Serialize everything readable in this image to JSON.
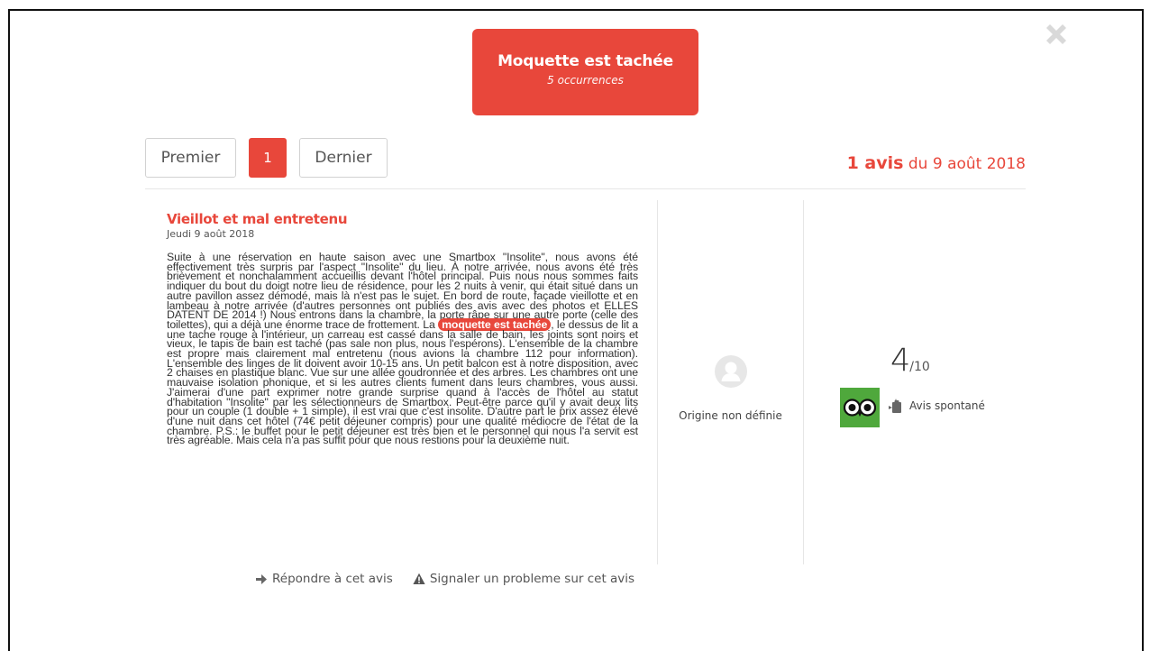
{
  "hero": {
    "title": "Moquette est tachée",
    "subtitle": "5 occurrences"
  },
  "pagination": {
    "first_label": "Premier",
    "current_page": "1",
    "last_label": "Dernier"
  },
  "summary": {
    "count_label": "1 avis",
    "date_label": "du 9 août 2018"
  },
  "review": {
    "title": "Vieillot et mal entretenu",
    "date": "Jeudi 9 août 2018",
    "body_before": "Suite à une réservation en haute saison avec une Smartbox \"Insolite\", nous avons été effectivement très surpris par l'aspect \"Insolite\" du lieu. À notre arrivée, nous avons été très brièvement et nonchalamment accueillis devant l'hôtel principal. Puis nous nous sommes faits indiquer du bout du doigt notre lieu de résidence, pour les 2 nuits à venir, qui était situé dans un autre pavillon assez démodé, mais là n'est pas le sujet. En bord de route, façade vieillotte et en lambeau à notre arrivée (d'autres personnes ont publiés des avis avec des photos et ELLES DATENT DE 2014 !) Nous entrons dans la chambre, la porte râpe sur une autre porte (celle des toilettes), qui a déjà une énorme trace de frottement. La ",
    "highlight": "moquette est tachée",
    "body_after": ", le dessus de lit a une tache rouge à l'intérieur, un carreau est cassé dans la salle de bain, les joints sont noirs et vieux, le tapis de bain est taché (pas sale non plus, nous l'espérons). L'ensemble de la chambre est propre mais clairement mal entretenu (nous avions la chambre 112 pour information). L'ensemble des linges de lit doivent avoir 10-15 ans. Un petit balcon est à notre disposition, avec 2 chaises en plastique blanc. Vue sur une allée goudronnée et des arbres. Les chambres ont une mauvaise isolation phonique, et si les autres clients fument dans leurs chambres, vous aussi. J'aimerai d'une part exprimer notre grande surprise quand à l'accès de l'hôtel au statut d'habitation \"Insolite\" par les sélectionneurs de Smartbox. Peut-être parce qu'il y avait deux lits pour un couple (1 double + 1 simple), il est vrai que c'est insolite. D'autre part le prix assez élevé d'une nuit dans cet hôtel (74€ petit déjeuner compris) pour une qualité médiocre de l'état de la chambre. P.S.: le buffet pour le petit déjeuner est très bien et le personnel qui nous l'a servit est très agréable. Mais cela n'a pas suffit pour que nous restions pour la deuxième nuit."
  },
  "actions": {
    "reply_label": "Répondre à cet avis",
    "report_label": "Signaler un probleme sur cet avis"
  },
  "origin": {
    "label": "Origine non définie",
    "avatar_icon": "user-avatar-icon"
  },
  "rating": {
    "value": "4",
    "max": "/10"
  },
  "source": {
    "logo_icon": "tripadvisor-owl-icon",
    "logo_color": "#4fa83c",
    "type_label": "Avis spontané",
    "type_icon": "spontaneous-review-icon"
  },
  "colors": {
    "accent": "#e8473b"
  }
}
